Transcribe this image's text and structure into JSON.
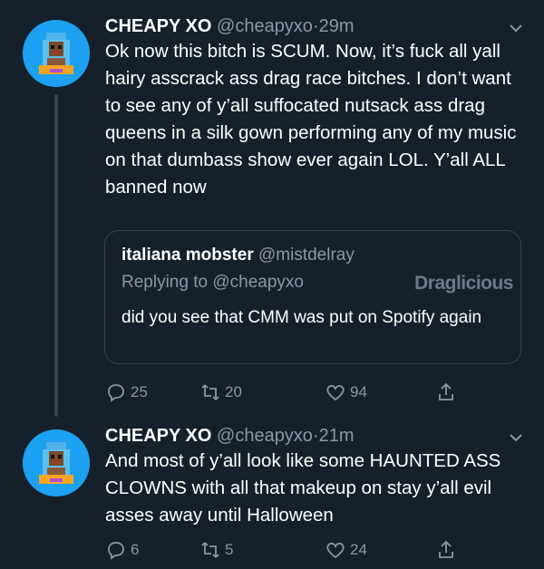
{
  "tweets": [
    {
      "name": "CHEAPY XO",
      "handle": "@cheapyxo",
      "dot": "·",
      "time": "29m",
      "text": "Ok now this bitch is SCUM. Now, it’s fuck all yall hairy asscrack ass drag race bitches. I don’t want to see any of y’all suffocated nutsack ass drag queens in a silk gown performing any of my music on that dumbass show ever again LOL. Y’all ALL banned now",
      "quote": {
        "name": "italiana mobster",
        "handle": "@mistdelray",
        "replying": "Replying to @cheapyxo",
        "text": "did you see that CMM was put on Spotify again",
        "watermark": "Draglicious"
      },
      "replies": "25",
      "retweets": "20",
      "likes": "94"
    },
    {
      "name": "CHEAPY XO",
      "handle": "@cheapyxo",
      "dot": "·",
      "time": "21m",
      "text": "And most of y’all look like some HAUNTED ASS CLOWNS with all that makeup on stay y’all evil asses away until Halloween",
      "replies": "6",
      "retweets": "5",
      "likes": "24"
    }
  ],
  "colors": {
    "background": "#15202b",
    "muted": "#8899a6",
    "border": "#38444d",
    "avatar_bg": "#1da1f2"
  },
  "icons": [
    "avatar",
    "chevron-down-icon",
    "reply-icon",
    "retweet-icon",
    "heart-icon",
    "share-icon"
  ]
}
